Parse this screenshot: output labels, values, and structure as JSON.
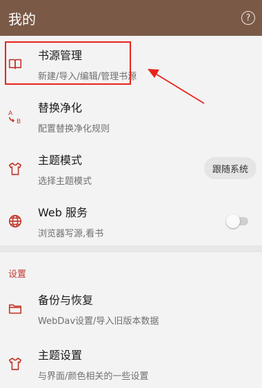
{
  "header": {
    "title": "我的",
    "help_icon": "help-circle-icon",
    "help_glyph": "?"
  },
  "menu_items": [
    {
      "label": "书源管理",
      "subtitle": "新建/导入/编辑/管理书源",
      "icon": "book-icon"
    },
    {
      "label": "替换净化",
      "subtitle": "配置替换净化规则",
      "icon": "replace-icon"
    },
    {
      "label": "主题模式",
      "subtitle": "选择主题模式",
      "icon": "shirt-icon",
      "value": "跟随系统"
    },
    {
      "label": "Web 服务",
      "subtitle": "浏览器写源,看书",
      "icon": "globe-icon",
      "toggle_on": false
    }
  ],
  "settings_section": {
    "header": "设置",
    "items": [
      {
        "label": "备份与恢复",
        "subtitle": "WebDav设置/导入旧版本数据",
        "icon": "folder-icon"
      },
      {
        "label": "主题设置",
        "subtitle": "与界面/颜色相关的一些设置",
        "icon": "shirt-icon"
      }
    ]
  },
  "colors": {
    "app_bar": "#7a5a47",
    "accent": "#c33a2f",
    "annotation": "#e8231c"
  }
}
